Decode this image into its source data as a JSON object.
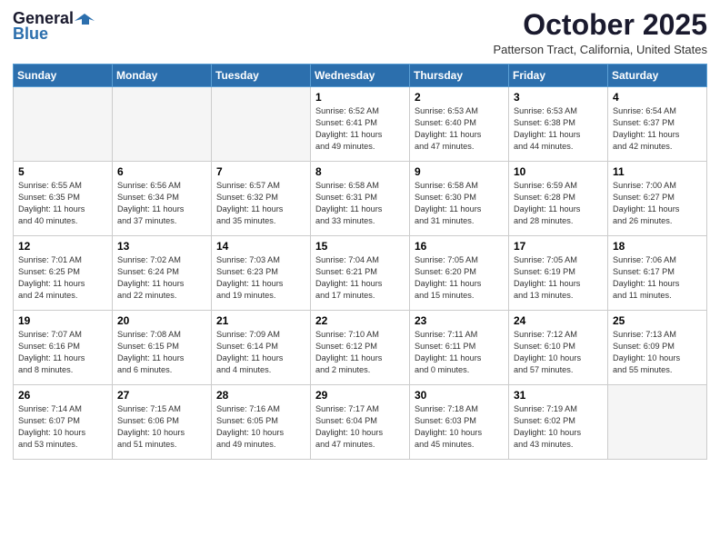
{
  "header": {
    "logo_general": "General",
    "logo_blue": "Blue",
    "month": "October 2025",
    "location": "Patterson Tract, California, United States"
  },
  "days_of_week": [
    "Sunday",
    "Monday",
    "Tuesday",
    "Wednesday",
    "Thursday",
    "Friday",
    "Saturday"
  ],
  "weeks": [
    [
      {
        "day": "",
        "content": ""
      },
      {
        "day": "",
        "content": ""
      },
      {
        "day": "",
        "content": ""
      },
      {
        "day": "1",
        "content": "Sunrise: 6:52 AM\nSunset: 6:41 PM\nDaylight: 11 hours\nand 49 minutes."
      },
      {
        "day": "2",
        "content": "Sunrise: 6:53 AM\nSunset: 6:40 PM\nDaylight: 11 hours\nand 47 minutes."
      },
      {
        "day": "3",
        "content": "Sunrise: 6:53 AM\nSunset: 6:38 PM\nDaylight: 11 hours\nand 44 minutes."
      },
      {
        "day": "4",
        "content": "Sunrise: 6:54 AM\nSunset: 6:37 PM\nDaylight: 11 hours\nand 42 minutes."
      }
    ],
    [
      {
        "day": "5",
        "content": "Sunrise: 6:55 AM\nSunset: 6:35 PM\nDaylight: 11 hours\nand 40 minutes."
      },
      {
        "day": "6",
        "content": "Sunrise: 6:56 AM\nSunset: 6:34 PM\nDaylight: 11 hours\nand 37 minutes."
      },
      {
        "day": "7",
        "content": "Sunrise: 6:57 AM\nSunset: 6:32 PM\nDaylight: 11 hours\nand 35 minutes."
      },
      {
        "day": "8",
        "content": "Sunrise: 6:58 AM\nSunset: 6:31 PM\nDaylight: 11 hours\nand 33 minutes."
      },
      {
        "day": "9",
        "content": "Sunrise: 6:58 AM\nSunset: 6:30 PM\nDaylight: 11 hours\nand 31 minutes."
      },
      {
        "day": "10",
        "content": "Sunrise: 6:59 AM\nSunset: 6:28 PM\nDaylight: 11 hours\nand 28 minutes."
      },
      {
        "day": "11",
        "content": "Sunrise: 7:00 AM\nSunset: 6:27 PM\nDaylight: 11 hours\nand 26 minutes."
      }
    ],
    [
      {
        "day": "12",
        "content": "Sunrise: 7:01 AM\nSunset: 6:25 PM\nDaylight: 11 hours\nand 24 minutes."
      },
      {
        "day": "13",
        "content": "Sunrise: 7:02 AM\nSunset: 6:24 PM\nDaylight: 11 hours\nand 22 minutes."
      },
      {
        "day": "14",
        "content": "Sunrise: 7:03 AM\nSunset: 6:23 PM\nDaylight: 11 hours\nand 19 minutes."
      },
      {
        "day": "15",
        "content": "Sunrise: 7:04 AM\nSunset: 6:21 PM\nDaylight: 11 hours\nand 17 minutes."
      },
      {
        "day": "16",
        "content": "Sunrise: 7:05 AM\nSunset: 6:20 PM\nDaylight: 11 hours\nand 15 minutes."
      },
      {
        "day": "17",
        "content": "Sunrise: 7:05 AM\nSunset: 6:19 PM\nDaylight: 11 hours\nand 13 minutes."
      },
      {
        "day": "18",
        "content": "Sunrise: 7:06 AM\nSunset: 6:17 PM\nDaylight: 11 hours\nand 11 minutes."
      }
    ],
    [
      {
        "day": "19",
        "content": "Sunrise: 7:07 AM\nSunset: 6:16 PM\nDaylight: 11 hours\nand 8 minutes."
      },
      {
        "day": "20",
        "content": "Sunrise: 7:08 AM\nSunset: 6:15 PM\nDaylight: 11 hours\nand 6 minutes."
      },
      {
        "day": "21",
        "content": "Sunrise: 7:09 AM\nSunset: 6:14 PM\nDaylight: 11 hours\nand 4 minutes."
      },
      {
        "day": "22",
        "content": "Sunrise: 7:10 AM\nSunset: 6:12 PM\nDaylight: 11 hours\nand 2 minutes."
      },
      {
        "day": "23",
        "content": "Sunrise: 7:11 AM\nSunset: 6:11 PM\nDaylight: 11 hours\nand 0 minutes."
      },
      {
        "day": "24",
        "content": "Sunrise: 7:12 AM\nSunset: 6:10 PM\nDaylight: 10 hours\nand 57 minutes."
      },
      {
        "day": "25",
        "content": "Sunrise: 7:13 AM\nSunset: 6:09 PM\nDaylight: 10 hours\nand 55 minutes."
      }
    ],
    [
      {
        "day": "26",
        "content": "Sunrise: 7:14 AM\nSunset: 6:07 PM\nDaylight: 10 hours\nand 53 minutes."
      },
      {
        "day": "27",
        "content": "Sunrise: 7:15 AM\nSunset: 6:06 PM\nDaylight: 10 hours\nand 51 minutes."
      },
      {
        "day": "28",
        "content": "Sunrise: 7:16 AM\nSunset: 6:05 PM\nDaylight: 10 hours\nand 49 minutes."
      },
      {
        "day": "29",
        "content": "Sunrise: 7:17 AM\nSunset: 6:04 PM\nDaylight: 10 hours\nand 47 minutes."
      },
      {
        "day": "30",
        "content": "Sunrise: 7:18 AM\nSunset: 6:03 PM\nDaylight: 10 hours\nand 45 minutes."
      },
      {
        "day": "31",
        "content": "Sunrise: 7:19 AM\nSunset: 6:02 PM\nDaylight: 10 hours\nand 43 minutes."
      },
      {
        "day": "",
        "content": ""
      }
    ]
  ]
}
